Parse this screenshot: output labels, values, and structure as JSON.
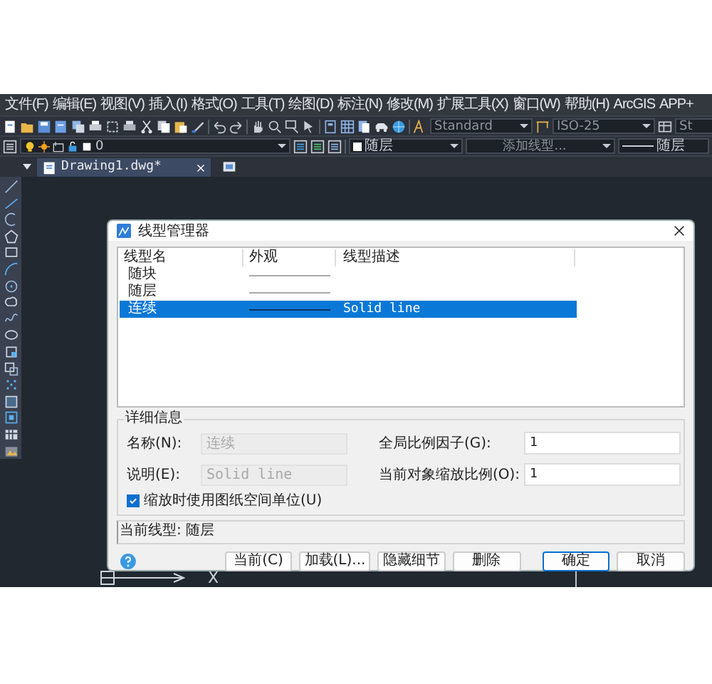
{
  "menu": [
    "文件(F)",
    "编辑(E)",
    "视图(V)",
    "插入(I)",
    "格式(O)",
    "工具(T)",
    "绘图(D)",
    "标注(N)",
    "修改(M)",
    "扩展工具(X)",
    "窗口(W)",
    "帮助(H)",
    "ArcGIS",
    "APP+"
  ],
  "toolbar": {
    "text_style": "Standard",
    "dim_style": "ISO-25",
    "table_style": "St"
  },
  "properties_bar": {
    "layer": "0",
    "color_setting": "随层",
    "linetype": "添加线型...",
    "lineweight": "随层"
  },
  "tabs": [
    {
      "label": "Drawing1.dwg*",
      "selected": true
    }
  ],
  "dialog": {
    "title": "线型管理器",
    "columns": [
      "线型名",
      "外观",
      "线型描述"
    ],
    "rows": [
      {
        "name": "随块",
        "selected": false
      },
      {
        "name": "随层",
        "selected": false
      },
      {
        "name": "连续",
        "description": "Solid line",
        "selected": true
      }
    ],
    "details": {
      "title": "详细信息",
      "name_label": "名称(N):",
      "name_value": "连续",
      "desc_label": "说明(E):",
      "desc_value": "Solid line",
      "global_scale_label": "全局比例因子(G):",
      "global_scale": "1",
      "object_scale_label": "当前对象缩放比例(O):",
      "object_scale": "1",
      "paper_space": {
        "label": "缩放时使用图纸空间单位(U)",
        "checked": true
      }
    },
    "current_linetype": "当前线型: 随层",
    "buttons": [
      {
        "label": "当前(C)",
        "kind": "normal"
      },
      {
        "label": "加载(L)...",
        "kind": "normal"
      },
      {
        "label": "隐藏细节",
        "kind": "normal"
      },
      {
        "label": "删除",
        "kind": "normal"
      },
      {
        "label": "确定",
        "kind": "default"
      },
      {
        "label": "取消",
        "kind": "normal"
      }
    ]
  },
  "canvas": {
    "axis_label": "X"
  }
}
